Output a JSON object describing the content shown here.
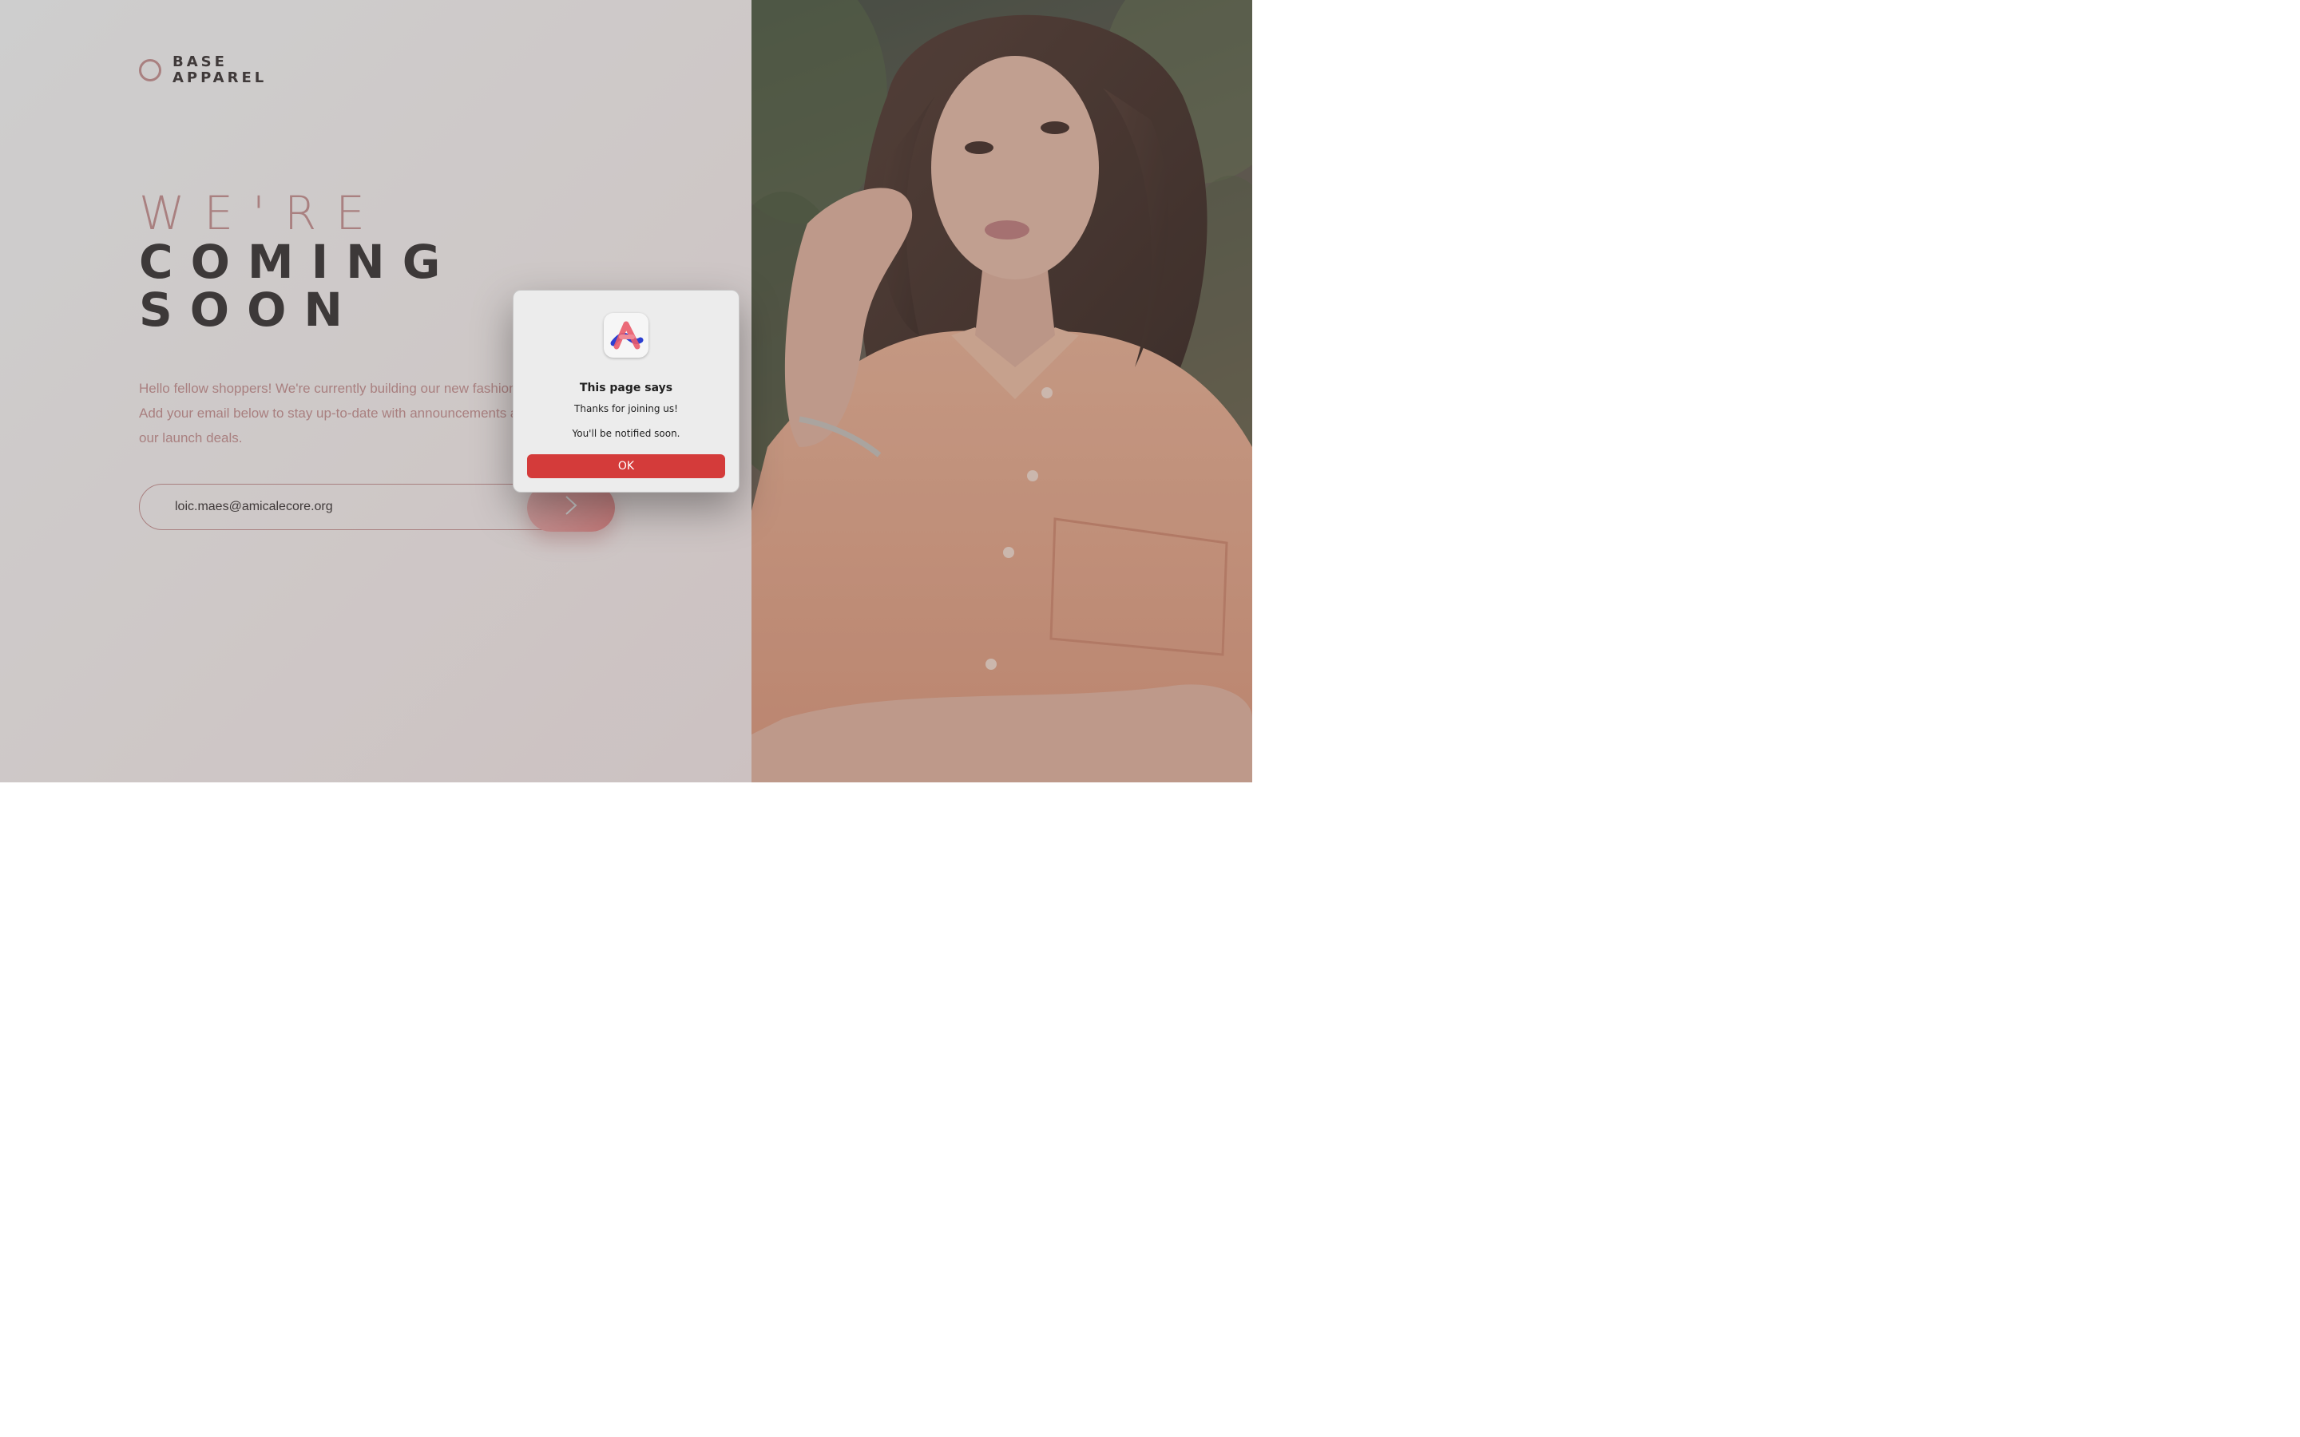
{
  "brand": {
    "line1": "BASE",
    "line2": "APPAREL"
  },
  "headline": {
    "line1": "WE'RE",
    "line2": "COMING",
    "line3": "SOON"
  },
  "intro_text": "Hello fellow shoppers! We're currently building our new fashion store. Add your email below to stay up-to-date with announcements and our launch deals.",
  "form": {
    "email_value": "loic.maes@amicalecore.org",
    "submit_icon": "chevron-right-icon"
  },
  "dialog": {
    "app_icon": "arc-browser-icon",
    "title": "This page says",
    "message_line1": "Thanks for joining us!",
    "message_line2": "You'll be notified soon.",
    "ok_label": "OK"
  },
  "colors": {
    "accent": "#ce9797",
    "heading_dark": "#3e3838",
    "ok_button": "#d43b3a"
  }
}
